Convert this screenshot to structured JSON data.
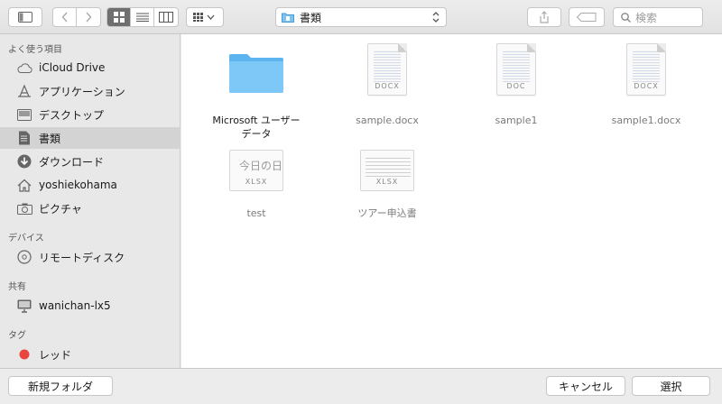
{
  "toolbar": {
    "path_label": "書類",
    "search_placeholder": "検索"
  },
  "sidebar": {
    "sections": {
      "favorites": "よく使う項目",
      "devices": "デバイス",
      "shared": "共有",
      "tags": "タグ"
    },
    "favorites": [
      {
        "label": "iCloud Drive",
        "icon": "cloud-icon"
      },
      {
        "label": "アプリケーション",
        "icon": "applications-icon"
      },
      {
        "label": "デスクトップ",
        "icon": "desktop-icon"
      },
      {
        "label": "書類",
        "icon": "documents-icon",
        "selected": true
      },
      {
        "label": "ダウンロード",
        "icon": "download-icon"
      },
      {
        "label": "yoshiekohama",
        "icon": "home-icon"
      },
      {
        "label": "ピクチャ",
        "icon": "camera-icon"
      }
    ],
    "devices": [
      {
        "label": "リモートディスク",
        "icon": "disc-icon"
      }
    ],
    "shared": [
      {
        "label": "wanichan-lx5",
        "icon": "computer-icon"
      }
    ],
    "tags": [
      {
        "label": "レッド",
        "color": "#e8453c"
      }
    ]
  },
  "files": [
    {
      "name_line1": "Microsoft ユーザー",
      "name_line2": "データ",
      "kind": "folder"
    },
    {
      "name": "sample.docx",
      "kind": "docx",
      "ext": "DOCX"
    },
    {
      "name": "sample1",
      "kind": "docx",
      "ext": "DOC"
    },
    {
      "name": "sample1.docx",
      "kind": "docx",
      "ext": "DOCX"
    },
    {
      "name": "test",
      "kind": "xlsx",
      "ext": "XLSX",
      "preview_text": "今日の日"
    },
    {
      "name": "ツアー申込書",
      "kind": "xlsx",
      "ext": "XLSX"
    }
  ],
  "footer": {
    "new_folder": "新規フォルダ",
    "cancel": "キャンセル",
    "select": "選択"
  },
  "colors": {
    "folder": "#6ec0f5",
    "selection": "#d3d3d3",
    "tag_red": "#e8453c"
  }
}
